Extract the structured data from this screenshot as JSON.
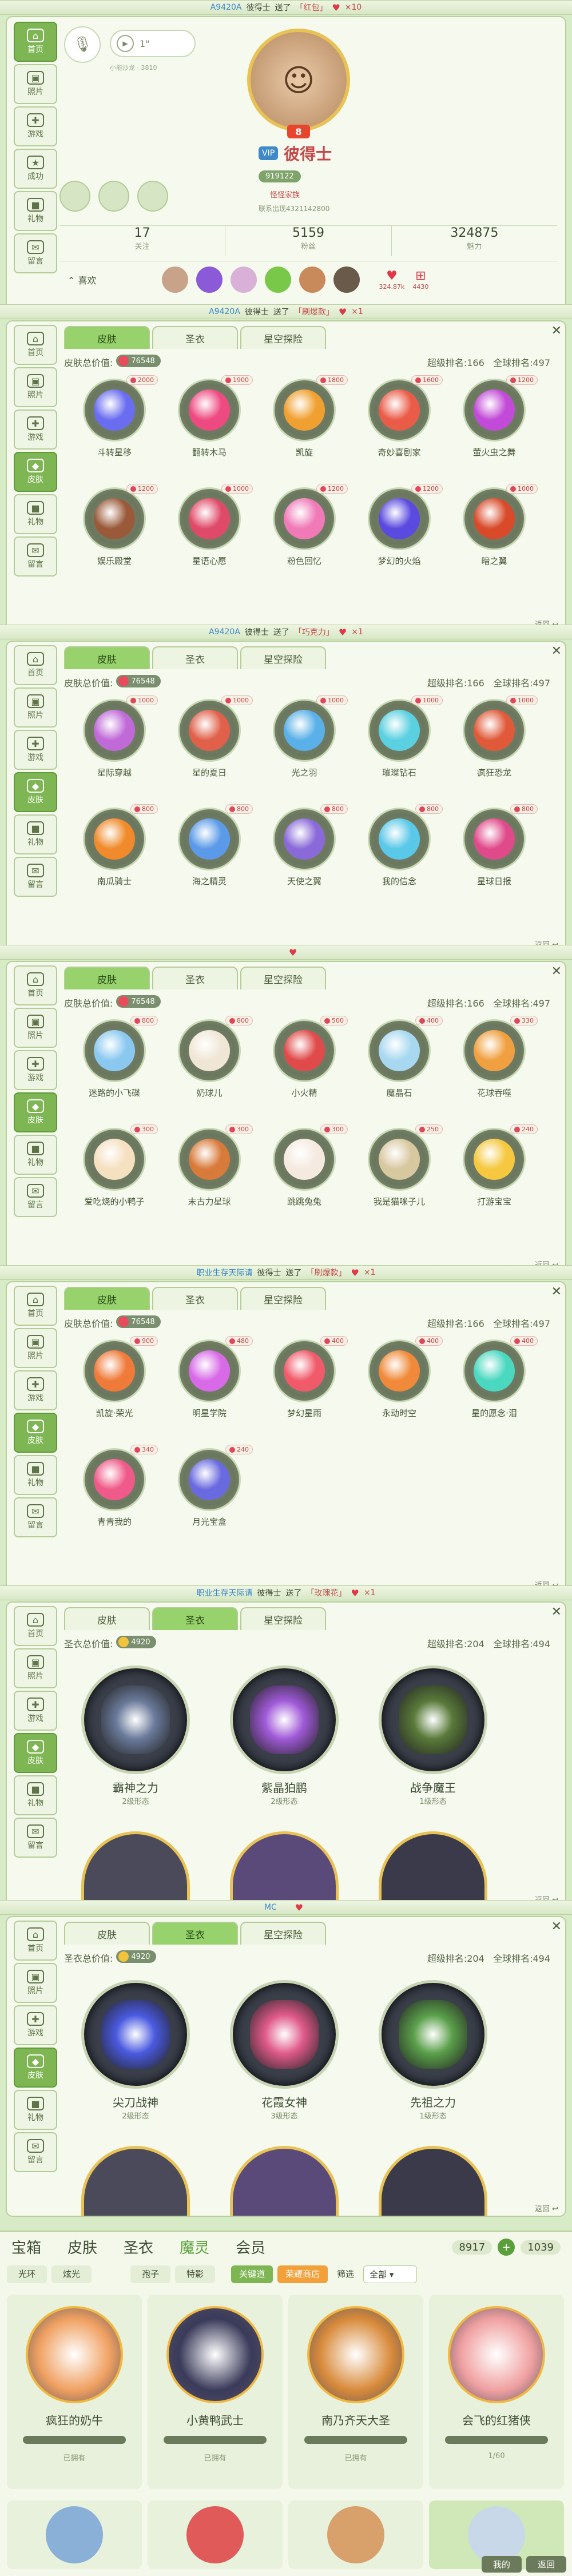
{
  "profile": {
    "sidebar": [
      "首页",
      "照片",
      "游戏",
      "成功",
      "礼物",
      "留言"
    ],
    "mic_label": "1\"",
    "small_id": "小能沙龙 · 3810",
    "level": "8",
    "name": "彼得士",
    "id_label": "919122",
    "club_label": "怪怪家族",
    "birthday": "联系出现4321142800",
    "stats": [
      {
        "value": "17",
        "label": "关注"
      },
      {
        "value": "5159",
        "label": "粉丝"
      },
      {
        "value": "324875",
        "label": "魅力"
      }
    ],
    "like_label": "喜欢",
    "like_counts": [
      "324.87k",
      "4430"
    ],
    "back": "返回"
  },
  "gift_strips": [
    {
      "id": "A9420A",
      "who": "彼得士",
      "verb": "送了",
      "item": "「红包」",
      "count": "×10"
    },
    {
      "id": "A9420A",
      "who": "彼得士",
      "verb": "送了",
      "item": "「刷爆款」",
      "count": "×1"
    },
    {
      "id": "A9420A",
      "who": "彼得士",
      "verb": "送了",
      "item": "「巧克力」",
      "count": "×1"
    },
    {
      "id": "",
      "who": "",
      "verb": "",
      "item": "",
      "count": ""
    },
    {
      "id": "职业生存天际请",
      "who": "彼得士",
      "verb": "送了",
      "item": "「刷爆款」",
      "count": "×1"
    },
    {
      "id": "职业生存天际请",
      "who": "彼得士",
      "verb": "送了",
      "item": "「玫瑰花」",
      "count": "×1"
    },
    {
      "id": "MC",
      "who": "",
      "verb": "",
      "item": "",
      "count": ""
    }
  ],
  "tabs": [
    "皮肤",
    "圣衣",
    "星空探险"
  ],
  "skin_head": {
    "label": "皮肤总价值:",
    "coin": "76548",
    "rank": "超级排名:166",
    "global": "全球排名:497"
  },
  "cloth_head": {
    "label": "圣衣总价值:",
    "coin": "4920",
    "rank": "超级排名:204",
    "global": "全球排名:494"
  },
  "skins1": [
    {
      "name": "斗转星移",
      "price": "2000",
      "c": "#6a6df0"
    },
    {
      "name": "翻转木马",
      "price": "1900",
      "c": "#ee4a82"
    },
    {
      "name": "凯旋",
      "price": "1800",
      "c": "#f0a030"
    },
    {
      "name": "奇妙喜剧家",
      "price": "1600",
      "c": "#ea5b48"
    },
    {
      "name": "萤火虫之舞",
      "price": "1200",
      "c": "#c24ad8"
    },
    {
      "name": "娱乐殿堂",
      "price": "1200",
      "c": "#9a5a3a"
    },
    {
      "name": "星语心愿",
      "price": "1000",
      "c": "#e04a6a"
    },
    {
      "name": "粉色回忆",
      "price": "1200",
      "c": "#f07ab8"
    },
    {
      "name": "梦幻的火焰",
      "price": "1200",
      "c": "#5a4ae0"
    },
    {
      "name": "暗之翼",
      "price": "1000",
      "c": "#d84a2a"
    }
  ],
  "skins2": [
    {
      "name": "星际穿越",
      "price": "1000",
      "c": "#c06ad8"
    },
    {
      "name": "星的夏日",
      "price": "1000",
      "c": "#e0604a"
    },
    {
      "name": "光之羽",
      "price": "1000",
      "c": "#5ab0e8"
    },
    {
      "name": "璀璨钻石",
      "price": "1000",
      "c": "#5ad0e0"
    },
    {
      "name": "疯狂恐龙",
      "price": "1000",
      "c": "#e05a3a"
    },
    {
      "name": "南瓜骑士",
      "price": "800",
      "c": "#f08a2a"
    },
    {
      "name": "海之精灵",
      "price": "800",
      "c": "#5a9ae8"
    },
    {
      "name": "天使之翼",
      "price": "800",
      "c": "#8a6ad8"
    },
    {
      "name": "我的信念",
      "price": "800",
      "c": "#5ac8e8"
    },
    {
      "name": "星球日报",
      "price": "800",
      "c": "#e04a8a"
    }
  ],
  "skins3": [
    {
      "name": "迷路的小飞碟",
      "price": "800",
      "c": "#8ac8f0"
    },
    {
      "name": "奶球儿",
      "price": "800",
      "c": "#f0e6d6"
    },
    {
      "name": "小火精",
      "price": "500",
      "c": "#e04a4a"
    },
    {
      "name": "魔晶石",
      "price": "400",
      "c": "#a8d8f0"
    },
    {
      "name": "花球吞噬",
      "price": "330",
      "c": "#f0a040"
    },
    {
      "name": "爱吃烧的小鸭子",
      "price": "300",
      "c": "#f5e0c0"
    },
    {
      "name": "末古力星球",
      "price": "300",
      "c": "#d87a3a"
    },
    {
      "name": "跳跳兔兔",
      "price": "300",
      "c": "#f5eae0"
    },
    {
      "name": "我是猫咪子儿",
      "price": "250",
      "c": "#d8c8a0"
    },
    {
      "name": "打游宝宝",
      "price": "240",
      "c": "#f5c840"
    }
  ],
  "skins4": [
    {
      "name": "凯旋·荣光",
      "price": "900",
      "c": "#f07a3a"
    },
    {
      "name": "明星学院",
      "price": "480",
      "c": "#d86ae8"
    },
    {
      "name": "梦幻星雨",
      "price": "400",
      "c": "#f05a6a"
    },
    {
      "name": "永动时空",
      "price": "400",
      "c": "#f08a3a"
    },
    {
      "name": "星的愿念·泪",
      "price": "400",
      "c": "#4ad8c0"
    },
    {
      "name": "青青我的",
      "price": "340",
      "c": "#f05a8a"
    },
    {
      "name": "月光宝盒",
      "price": "240",
      "c": "#6a6ae0"
    }
  ],
  "cloth1": [
    {
      "name": "霸神之力",
      "sub": "2级形态",
      "c": "#6a7a9a"
    },
    {
      "name": "紫晶狛鹏",
      "sub": "2级形态",
      "c": "#a05ad8"
    },
    {
      "name": "战争魔王",
      "sub": "1级形态",
      "c": "#5a7a3a"
    }
  ],
  "cloth2": [
    {
      "name": "尖刀战神",
      "sub": "2级形态",
      "c": "#4a5ae0"
    },
    {
      "name": "花霞女神",
      "sub": "3级形态",
      "c": "#e05a8a"
    },
    {
      "name": "先祖之力",
      "sub": "1级形态",
      "c": "#5aa04a"
    }
  ],
  "shop": {
    "tabs": [
      "宝箱",
      "皮肤",
      "圣衣",
      "魔灵",
      "会员"
    ],
    "subtabs": [
      "光环",
      "炫光",
      "孢子",
      "特影",
      "关键道",
      "荣耀商店",
      "筛选",
      "全部"
    ],
    "coins": [
      "8917",
      "1039"
    ],
    "items": [
      {
        "name": "疯狂的奶牛",
        "status": "已拥有",
        "c": "#f0a060"
      },
      {
        "name": "小黄鸭武士",
        "status": "已拥有",
        "c": "#3a3a5a"
      },
      {
        "name": "南乃齐天大圣",
        "status": "已拥有",
        "c": "#d88a3a"
      },
      {
        "name": "会飞的红猪侠",
        "status": "1/60",
        "c": "#f0a0a0"
      }
    ],
    "bottom": [
      "我的",
      "返回"
    ]
  }
}
